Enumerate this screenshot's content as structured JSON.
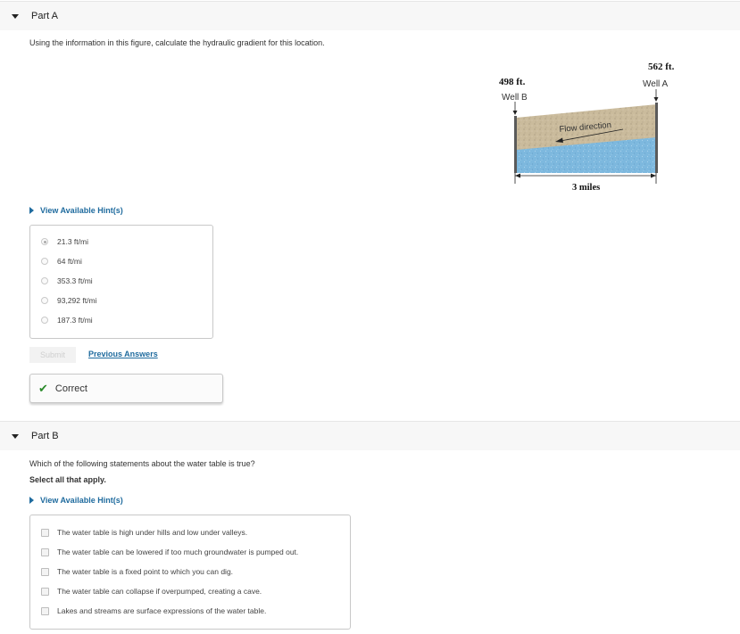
{
  "part_a": {
    "title": "Part A",
    "question": "Using the information in this figure, calculate the hydraulic gradient for this location.",
    "hint_label": "View Available Hint(s)",
    "options": [
      "21.3 ft/mi",
      "64 ft/mi",
      "353.3 ft/mi",
      "93,292 ft/mi",
      "187.3 ft/mi"
    ],
    "selected_index": 0,
    "submit_label": "Submit",
    "previous_answers_label": "Previous Answers",
    "feedback": "Correct"
  },
  "figure": {
    "well_b_elevation": "498 ft.",
    "well_b_label": "Well B",
    "well_a_elevation": "562 ft.",
    "well_a_label": "Well A",
    "flow_label": "Flow direction",
    "distance_label": "3 miles",
    "colors": {
      "soil": "#c8b99a",
      "water": "#7ab7dd",
      "well": "#5a5a5a"
    }
  },
  "part_b": {
    "title": "Part B",
    "question": "Which of the following statements about the water table is true?",
    "instruction": "Select all that apply.",
    "hint_label": "View Available Hint(s)",
    "options": [
      "The water table is high under hills and low under valleys.",
      "The water table can be lowered if too much groundwater is pumped out.",
      "The water table is a fixed point to which you can dig.",
      "The water table can collapse if overpumped, creating a cave.",
      "Lakes and streams are surface expressions of the water table."
    ]
  },
  "colors": {
    "link": "#1f6b9e",
    "correct_check": "#2a8a2a",
    "header_bg": "#f7f7f7"
  }
}
